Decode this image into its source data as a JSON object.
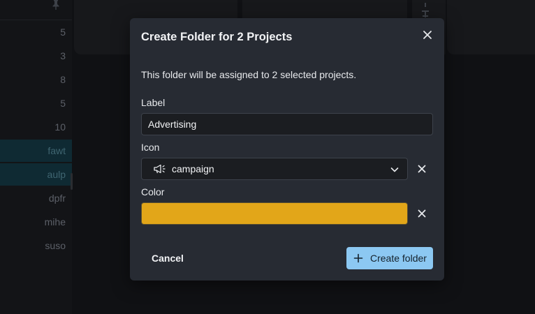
{
  "background": {
    "sidebar_counts": [
      "5",
      "3",
      "8",
      "5",
      "10"
    ],
    "sidebar_tags": [
      "fawt",
      "aulp",
      "dpfr",
      "mihe",
      "suso"
    ]
  },
  "dialog": {
    "title": "Create Folder for 2 Projects",
    "description": "This folder will be assigned to 2 selected projects.",
    "label_field": {
      "label": "Label",
      "value": "Advertising"
    },
    "icon_field": {
      "label": "Icon",
      "selected": "campaign",
      "icon": "megaphone-icon"
    },
    "color_field": {
      "label": "Color",
      "value_hex": "#e2a619"
    },
    "cancel_label": "Cancel",
    "create_label": "Create folder"
  },
  "colors": {
    "accent": "#8cc8f2",
    "dialog_bg": "#272b33"
  }
}
